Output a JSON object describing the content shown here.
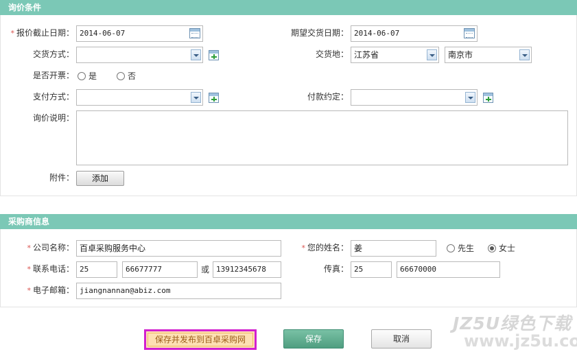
{
  "inquiry": {
    "section_title": "询价条件",
    "deadline": {
      "label": "报价截止日期：",
      "value": "2014-06-07"
    },
    "expected_date": {
      "label": "期望交货日期：",
      "value": "2014-06-07"
    },
    "delivery_method": {
      "label": "交货方式：",
      "value": ""
    },
    "delivery_place": {
      "label": "交货地：",
      "province": "江苏省",
      "city": "南京市"
    },
    "invoice": {
      "label": "是否开票：",
      "options": [
        "是",
        "否"
      ],
      "selected": ""
    },
    "payment_method": {
      "label": "支付方式：",
      "value": ""
    },
    "payment_terms": {
      "label": "付款约定：",
      "value": ""
    },
    "description": {
      "label": "询价说明：",
      "value": ""
    },
    "attachment": {
      "label": "附件：",
      "button": "添加"
    }
  },
  "buyer": {
    "section_title": "采购商信息",
    "company": {
      "label": "公司名称：",
      "value": "百卓采购服务中心"
    },
    "name": {
      "label": "您的姓名：",
      "value": "姜"
    },
    "gender": {
      "options": [
        "先生",
        "女士"
      ],
      "selected": "女士"
    },
    "phone": {
      "label": "联系电话：",
      "area": "25",
      "number": "66677777",
      "or": "或",
      "mobile": "13912345678"
    },
    "fax": {
      "label": "传真：",
      "area": "25",
      "number": "66670000"
    },
    "email": {
      "label": "电子邮箱：",
      "value": "jiangnannan@abiz.com"
    }
  },
  "actions": {
    "publish": "保存并发布到百卓采购网",
    "save": "保存",
    "cancel": "取消"
  },
  "watermark": {
    "text": "JZ5U绿色下载",
    "url": "www.jz5u.com"
  },
  "colors": {
    "header": "#7bc8b6",
    "required": "#d9534f",
    "highlight": "#d21fcf",
    "save": "#4f9e80"
  }
}
